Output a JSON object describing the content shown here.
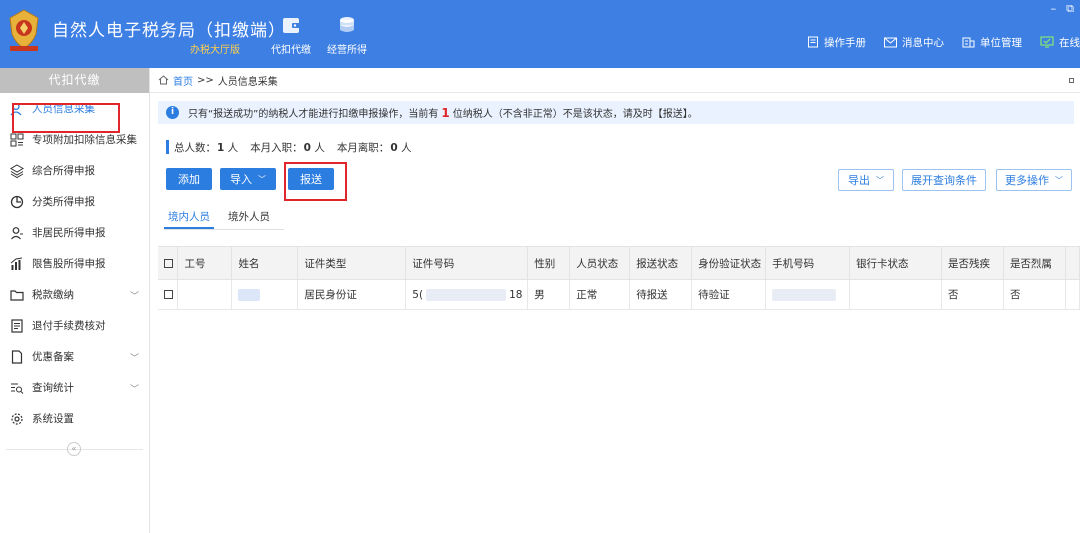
{
  "header": {
    "title": "自然人电子税务局（扣缴端）",
    "subtitle": "办税大厅版",
    "nav": [
      {
        "label": "代扣代缴",
        "icon": "wallet-icon"
      },
      {
        "label": "经营所得",
        "icon": "coins-icon"
      }
    ],
    "links": [
      {
        "label": "操作手册",
        "icon": "manual-icon"
      },
      {
        "label": "消息中心",
        "icon": "mail-icon"
      },
      {
        "label": "单位管理",
        "icon": "building-icon"
      },
      {
        "label": "在线",
        "icon": "monitor-icon"
      }
    ],
    "window_controls": [
      "–",
      "⧉"
    ]
  },
  "sidebar": {
    "header": "代扣代缴",
    "items": [
      {
        "label": "人员信息采集",
        "icon": "person-icon",
        "active": true
      },
      {
        "label": "专项附加扣除信息采集",
        "icon": "grid-icon"
      },
      {
        "label": "综合所得申报",
        "icon": "layers-icon"
      },
      {
        "label": "分类所得申报",
        "icon": "pie-icon"
      },
      {
        "label": "非居民所得申报",
        "icon": "user-icon"
      },
      {
        "label": "限售股所得申报",
        "icon": "bar-chart-icon"
      },
      {
        "label": "税款缴纳",
        "icon": "folder-icon",
        "expandable": true
      },
      {
        "label": "退付手续费核对",
        "icon": "receipt-icon"
      },
      {
        "label": "优惠备案",
        "icon": "document-icon",
        "expandable": true
      },
      {
        "label": "查询统计",
        "icon": "query-icon",
        "expandable": true
      },
      {
        "label": "系统设置",
        "icon": "gear-icon"
      }
    ],
    "collapse_glyph": "«"
  },
  "breadcrumb": {
    "home": "首页",
    "separator": ">>",
    "current": "人员信息采集"
  },
  "notice": {
    "prefix": "只有“报送成功”的纳税人才能进行扣缴申报操作，当前有",
    "count": "1",
    "suffix": "位纳税人（不含非正常）不是该状态，请及时【报送】。"
  },
  "stats": {
    "total_label": "总人数：",
    "total_value": "1",
    "total_unit": "人",
    "joined_label": "本月入职：",
    "joined_value": "0",
    "joined_unit": "人",
    "left_label": "本月离职：",
    "left_value": "0",
    "left_unit": "人"
  },
  "toolbar": {
    "add": "添加",
    "import": "导入",
    "report": "报送",
    "export": "导出",
    "expand_query": "展开查询条件",
    "more": "更多操作"
  },
  "tabs": [
    "境内人员",
    "境外人员"
  ],
  "table": {
    "columns": [
      "工号",
      "姓名",
      "证件类型",
      "证件号码",
      "性别",
      "人员状态",
      "报送状态",
      "身份验证状态",
      "手机号码",
      "银行卡状态",
      "是否残疾",
      "是否烈属"
    ],
    "rows": [
      {
        "id_type": "居民身份证",
        "id_number_start": "5(",
        "id_number_end": "18",
        "gender": "男",
        "status": "正常",
        "report_status": "待报送",
        "verify_status": "待验证",
        "disabled": "否",
        "martyr": "否"
      }
    ]
  }
}
